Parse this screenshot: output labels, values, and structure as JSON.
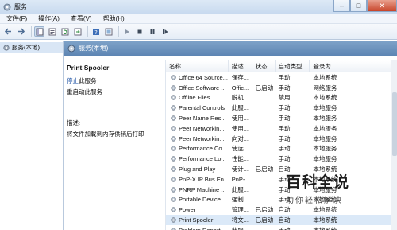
{
  "window": {
    "title": "服务"
  },
  "menu": [
    "文件(F)",
    "操作(A)",
    "查看(V)",
    "帮助(H)"
  ],
  "tree": {
    "root_label": "服务(本地)"
  },
  "header": {
    "label": "服务(本地)"
  },
  "detail": {
    "name": "Print Spooler",
    "stop_link": "停止",
    "stop_suffix": "此服务",
    "restart_link": "重启动",
    "restart_suffix": "此服务",
    "desc_title": "描述:",
    "desc_text": "将文件加载到内存供稍后打印"
  },
  "list": {
    "columns": [
      "名称",
      "描述",
      "状态",
      "启动类型",
      "登录为"
    ],
    "rows": [
      {
        "name": "Office 64 Source...",
        "desc": "保存...",
        "status": "",
        "startup": "手动",
        "logon": "本地系统"
      },
      {
        "name": "Office Software ...",
        "desc": "Offic...",
        "status": "已启动",
        "startup": "手动",
        "logon": "网络服务"
      },
      {
        "name": "Offline Files",
        "desc": "脱机...",
        "status": "",
        "startup": "禁用",
        "logon": "本地系统"
      },
      {
        "name": "Parental Controls",
        "desc": "此服...",
        "status": "",
        "startup": "手动",
        "logon": "本地服务"
      },
      {
        "name": "Peer Name Res...",
        "desc": "使用...",
        "status": "",
        "startup": "手动",
        "logon": "本地服务"
      },
      {
        "name": "Peer Networkin...",
        "desc": "使用...",
        "status": "",
        "startup": "手动",
        "logon": "本地服务"
      },
      {
        "name": "Peer Networkin...",
        "desc": "向对...",
        "status": "",
        "startup": "手动",
        "logon": "本地服务"
      },
      {
        "name": "Performance Co...",
        "desc": "使远...",
        "status": "",
        "startup": "手动",
        "logon": "本地服务"
      },
      {
        "name": "Performance Lo...",
        "desc": "性能...",
        "status": "",
        "startup": "手动",
        "logon": "本地服务"
      },
      {
        "name": "Plug and Play",
        "desc": "使计...",
        "status": "已启动",
        "startup": "自动",
        "logon": "本地系统"
      },
      {
        "name": "PnP-X IP Bus En...",
        "desc": "PnP-...",
        "status": "",
        "startup": "手动",
        "logon": "本地系统"
      },
      {
        "name": "PNRP Machine ...",
        "desc": "此服...",
        "status": "",
        "startup": "手动",
        "logon": "本地服务"
      },
      {
        "name": "Portable Device ...",
        "desc": "强制...",
        "status": "",
        "startup": "手动",
        "logon": "本地系统"
      },
      {
        "name": "Power",
        "desc": "管理...",
        "status": "已启动",
        "startup": "自动",
        "logon": "本地系统"
      },
      {
        "name": "Print Spooler",
        "desc": "将文...",
        "status": "已启动",
        "startup": "自动",
        "logon": "本地系统",
        "selected": true
      },
      {
        "name": "Problem Report...",
        "desc": "此服...",
        "status": "",
        "startup": "手动",
        "logon": "本地系统"
      }
    ]
  },
  "watermark": {
    "title": "百科全说",
    "subtitle": "助你轻松解决"
  },
  "colors": {
    "accent": "#5d85b3",
    "selected_row": "#dbe9f8",
    "link": "#1a4fa3"
  }
}
